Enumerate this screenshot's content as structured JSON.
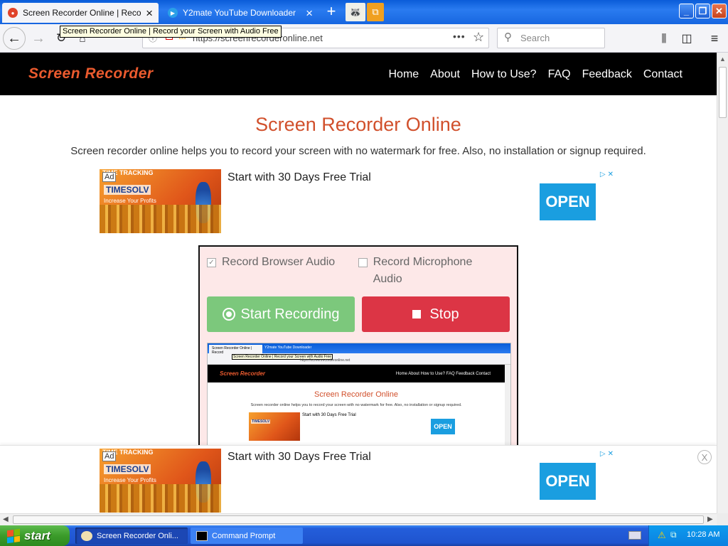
{
  "browser": {
    "tabs": [
      {
        "title": "Screen Recorder Online | Record y",
        "active": true
      },
      {
        "title": "Y2mate YouTube Downloader",
        "active": false
      }
    ],
    "tooltip": "Screen Recorder Online | Record your Screen with Audio Free",
    "url": "https://screenrecorderonline.net",
    "search_placeholder": "Search",
    "new_tab_symbol": "+",
    "window_controls": {
      "minimize": "_",
      "maximize": "❐",
      "close": "✕"
    }
  },
  "site": {
    "logo": "Screen Recorder",
    "nav": [
      "Home",
      "About",
      "How to Use?",
      "FAQ",
      "Feedback",
      "Contact"
    ],
    "heading": "Screen Recorder Online",
    "subheading": "Screen recorder online helps you to record your screen with no watermark for free. Also, no installation or signup required."
  },
  "ad": {
    "label": "Ad",
    "banner_top": "TIME TRACKING",
    "brand": "TIMESOLV",
    "tagline": "Increase Your Profits",
    "title": "Start with 30 Days Free Trial",
    "button": "OPEN",
    "choices": "▷✕"
  },
  "recorder": {
    "record_browser_audio": "Record Browser Audio",
    "record_browser_audio_checked": true,
    "record_microphone_audio": "Record Microphone Audio",
    "record_microphone_audio_checked": false,
    "start_label": "Start Recording",
    "stop_label": "Stop"
  },
  "preview": {
    "tab1": "Screen Recorder Online | Record",
    "tab2": "Y2mate YouTube Downloader",
    "tooltip": "Screen Recorder Online | Record your Screen with Audio Free",
    "url": "https://screenrecorderonline.net",
    "logo": "Screen Recorder",
    "menu": "Home   About   How to Use?   FAQ   Feedback   Contact",
    "heading": "Screen Recorder Online",
    "subheading": "Screen recorder online helps you to record your screen with no watermark for free. Also, no installation or signup required.",
    "ad_brand": "TIMESOLV",
    "ad_title": "Start with 30 Days Free Trial",
    "ad_button": "OPEN"
  },
  "sticky_close": "X",
  "taskbar": {
    "start": "start",
    "tasks": [
      {
        "label": "Screen Recorder Onli...",
        "active": true
      },
      {
        "label": "Command Prompt",
        "active": false
      }
    ],
    "clock": "10:28 AM"
  },
  "colors": {
    "accent": "#d1502c",
    "logo": "#ea5a2e",
    "start_button": "#7cc87c",
    "stop_button": "#dc3545",
    "ad_button": "#1a9ee0",
    "panel_bg": "#fde8e8"
  }
}
